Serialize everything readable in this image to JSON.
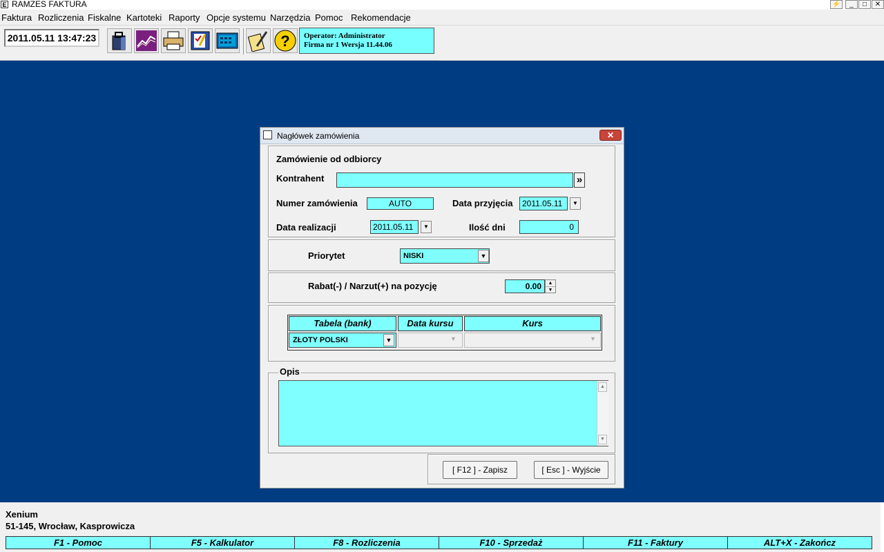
{
  "window": {
    "title": "RAMZES FAKTURA",
    "icon_letter": "E"
  },
  "menu": [
    "Faktura",
    "Rozliczenia",
    "Fiskalne",
    "Kartoteki",
    "Raporty",
    "Opcje systemu",
    "Narzędzia",
    "Pomoc",
    "Rekomendacje"
  ],
  "toolbar": {
    "datetime": "2011.05.11 13:47:23",
    "operator_line1": "Operator: Administrator",
    "operator_line2": "Firma nr 1   Wersja 11.44.06"
  },
  "dialog": {
    "title": "Nagłówek zamówienia",
    "close_label": "✕",
    "section_title": "Zamówienie od odbiorcy",
    "kontrahent_label": "Kontrahent",
    "kontrahent_value": "",
    "kontrahent_button": "»",
    "numer_label": "Numer zamówienia",
    "numer_value": "AUTO",
    "data_przyjecia_label": "Data przyjęcia",
    "data_przyjecia_value": "2011.05.11",
    "data_realizacji_label": "Data realizacji",
    "data_realizacji_value": "2011.05.11",
    "ilosc_dni_label": "Ilość dni",
    "ilosc_dni_value": "0",
    "priorytet_label": "Priorytet",
    "priorytet_value": "NISKI",
    "rabat_label": "Rabat(-) / Narzut(+) na pozycję",
    "rabat_value": "0.00",
    "grid_headers": [
      "Tabela (bank)",
      "Data kursu",
      "Kurs"
    ],
    "grid_row": {
      "tabela": "ZŁOTY POLSKI",
      "data_kursu": "",
      "kurs": ""
    },
    "opis_label": "Opis",
    "opis_value": "",
    "save_button": "[ F12 ] - Zapisz",
    "exit_button": "[ Esc ] - Wyjście"
  },
  "status": {
    "company_name": "Xenium",
    "company_address": "51-145, Wrocław, Kasprowicza"
  },
  "fkeys": [
    "F1 - Pomoc",
    "F5 - Kalkulator",
    "F8 - Rozliczenia",
    "F10 - Sprzedaż",
    "F11 - Faktury",
    "ALT+X - Zakończ"
  ]
}
